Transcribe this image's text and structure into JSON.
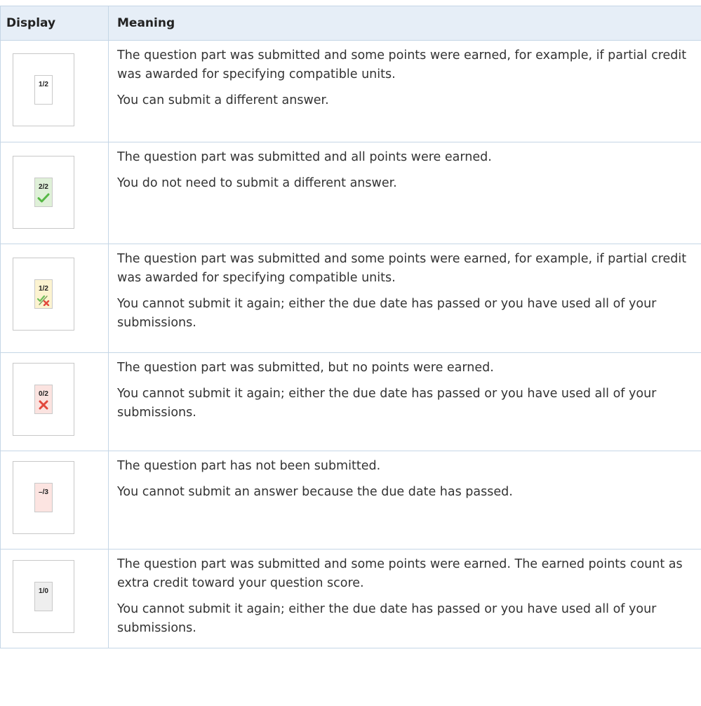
{
  "header": {
    "display": "Display",
    "meaning": "Meaning"
  },
  "rows": [
    {
      "score": "1/2",
      "status": "partial-open",
      "fill": "#ffffff",
      "icon": "",
      "paragraphs": [
        "The question part was submitted and some points were earned, for example, if partial credit was awarded for specifying compatible units.",
        "You can submit a different answer."
      ]
    },
    {
      "score": "2/2",
      "status": "correct",
      "fill": "#dff0d8",
      "icon": "check-icon",
      "paragraphs": [
        "The question part was submitted and all points were earned.",
        "You do not need to submit a different answer."
      ]
    },
    {
      "score": "1/2",
      "status": "partial-closed",
      "fill": "#fcf3d0",
      "icon": "partial-check-x-icon",
      "paragraphs": [
        "The question part was submitted and some points were earned, for example, if partial credit was awarded for specifying compatible units.",
        "You cannot submit it again; either the due date has passed or you have used all of your submissions."
      ]
    },
    {
      "score": "0/2",
      "status": "incorrect",
      "fill": "#fbe3e0",
      "icon": "x-icon",
      "paragraphs": [
        "The question part was submitted, but no points were earned.",
        "You cannot submit it again; either the due date has passed or you have used all of your submissions."
      ]
    },
    {
      "score": "–/3",
      "status": "not-submitted",
      "fill": "#fce4e1",
      "icon": "",
      "paragraphs": [
        "The question part has not been submitted.",
        "You cannot submit an answer because the due date has passed."
      ]
    },
    {
      "score": "1/0",
      "status": "extra-credit",
      "fill": "#eeeeee",
      "icon": "",
      "paragraphs": [
        "The question part was submitted and some points were earned. The earned points count as extra credit toward your question score.",
        "You cannot submit it again; either the due date has passed or you have used all of your submissions."
      ]
    }
  ]
}
